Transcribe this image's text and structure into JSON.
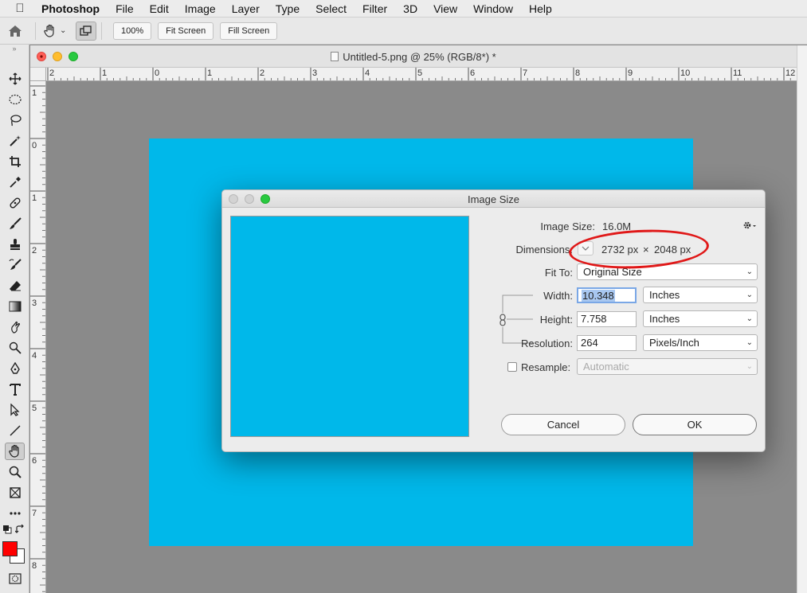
{
  "menubar": {
    "app": "Photoshop",
    "items": [
      "File",
      "Edit",
      "Image",
      "Layer",
      "Type",
      "Select",
      "Filter",
      "3D",
      "View",
      "Window",
      "Help"
    ]
  },
  "options_bar": {
    "zoom_100": "100%",
    "fit_screen": "Fit Screen",
    "fill_screen": "Fill Screen"
  },
  "document": {
    "title": "Untitled-5.png @ 25% (RGB/8*) *",
    "ruler_h_labels": [
      "2",
      "1",
      "0",
      "1",
      "2",
      "3",
      "4",
      "5",
      "6",
      "7",
      "8",
      "9",
      "10",
      "11",
      "12"
    ],
    "ruler_v_labels": [
      "1",
      "0",
      "1",
      "2",
      "3",
      "4",
      "5",
      "6",
      "7",
      "8"
    ],
    "canvas_color": "#00b8ea"
  },
  "dialog": {
    "title": "Image Size",
    "image_size_label": "Image Size:",
    "image_size_value": "16.0M",
    "dimensions_label": "Dimensions:",
    "dim_width": "2732 px",
    "dim_times": "×",
    "dim_height": "2048 px",
    "fit_to_label": "Fit To:",
    "fit_to_value": "Original Size",
    "width_label": "Width:",
    "width_value": "10.348",
    "width_unit": "Inches",
    "height_label": "Height:",
    "height_value": "7.758",
    "height_unit": "Inches",
    "resolution_label": "Resolution:",
    "resolution_value": "264",
    "resolution_unit": "Pixels/Inch",
    "resample_label": "Resample:",
    "resample_value": "Automatic",
    "cancel": "Cancel",
    "ok": "OK"
  },
  "colors": {
    "foreground": "#ff0000",
    "background": "#ffffff",
    "annotation": "#e01818"
  }
}
